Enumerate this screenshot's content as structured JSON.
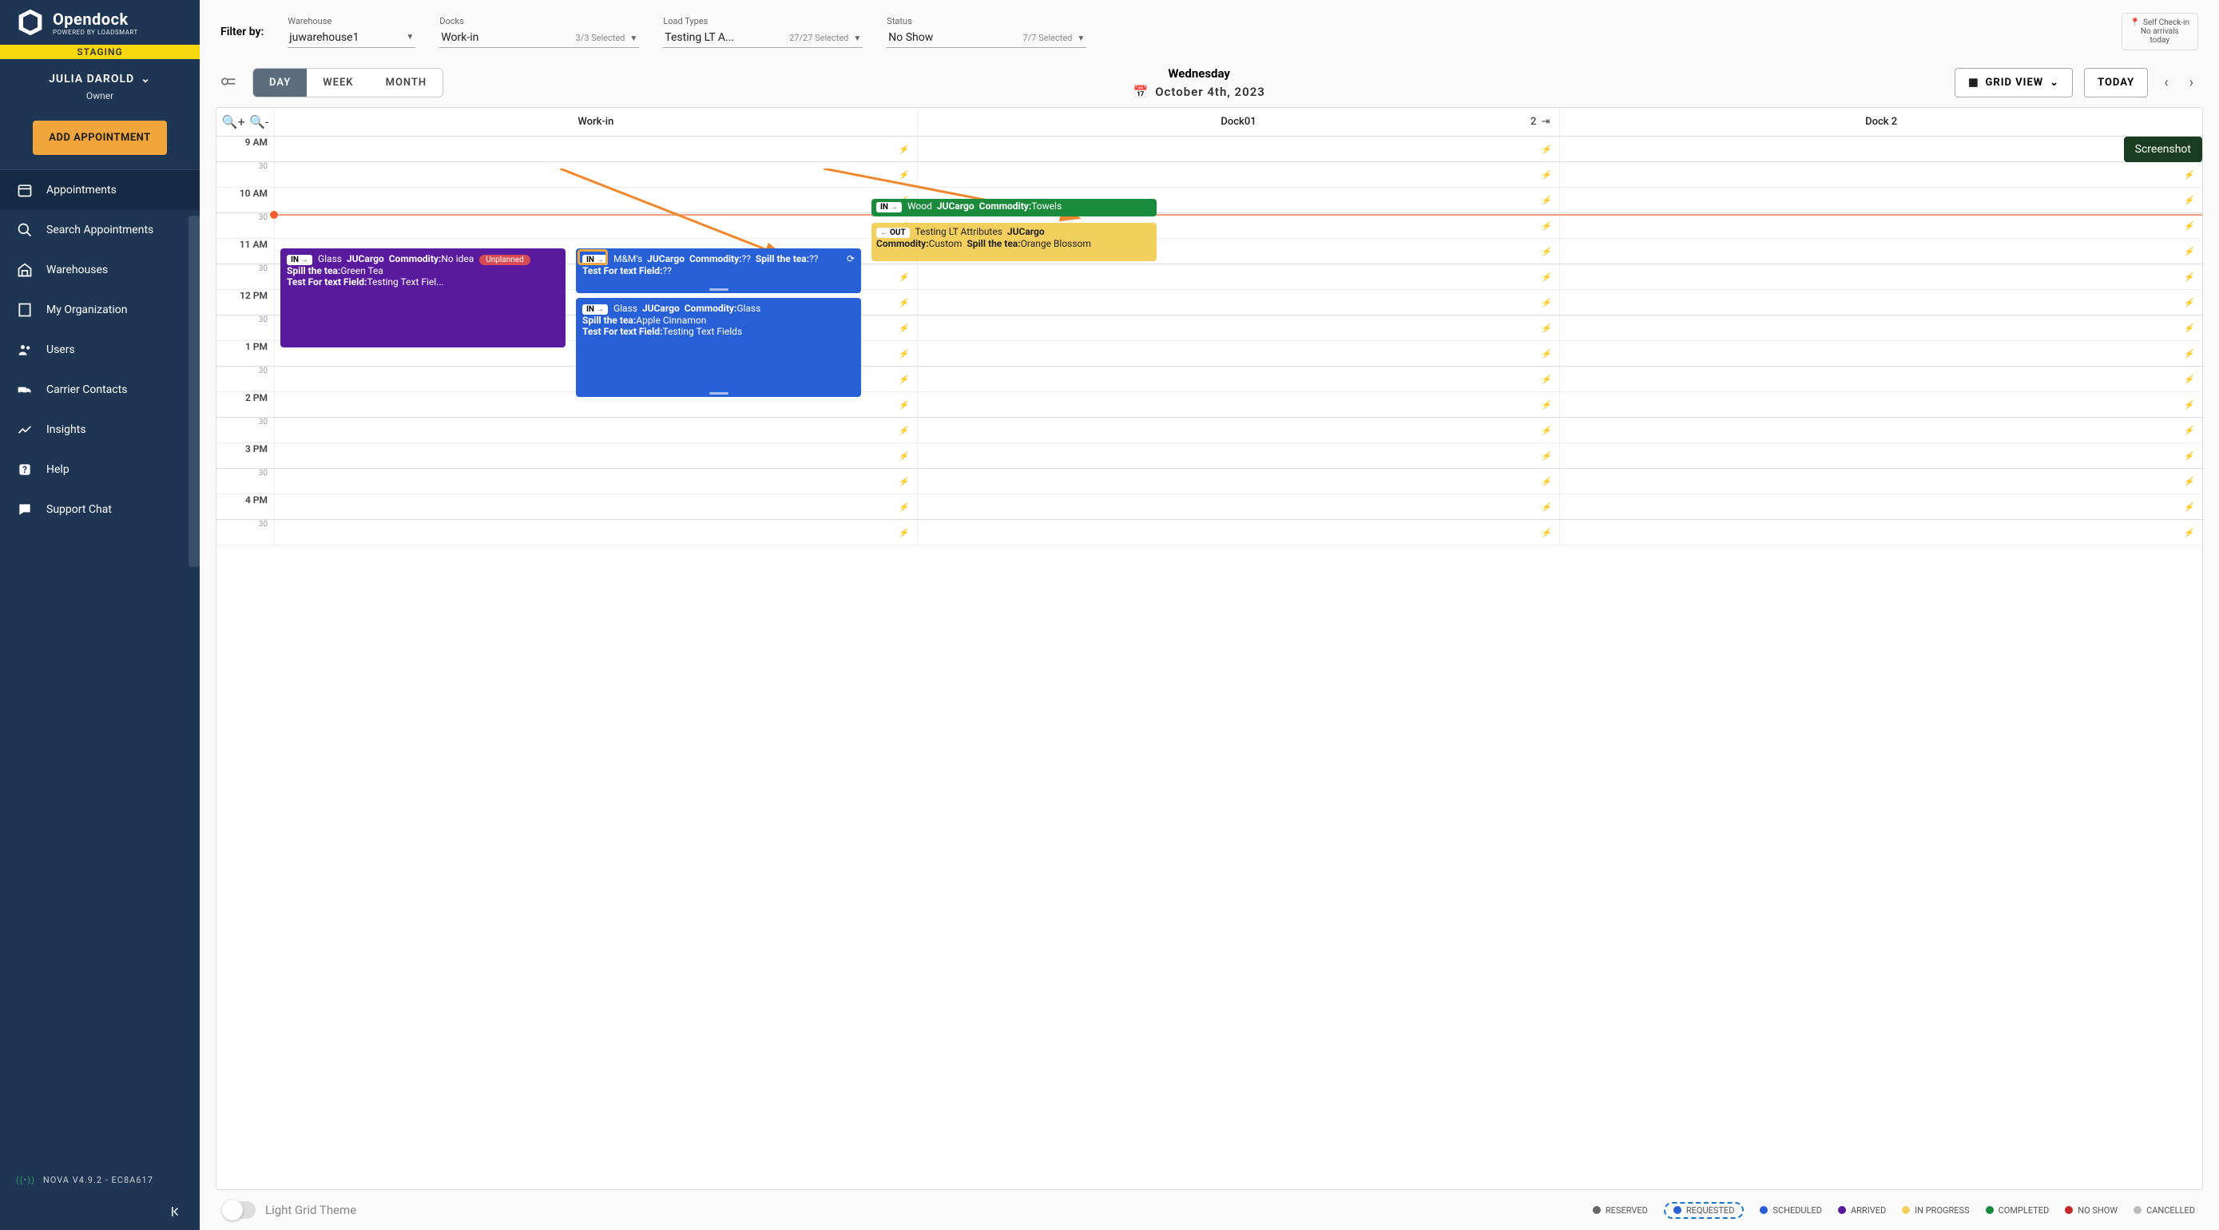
{
  "brand": {
    "name": "Opendock",
    "tagline": "POWERED BY LOADSMART",
    "env": "STAGING"
  },
  "user": {
    "name": "JULIA DAROLD",
    "role": "Owner"
  },
  "buttons": {
    "add_appointment": "ADD APPOINTMENT",
    "grid_view": "GRID VIEW",
    "today": "TODAY",
    "screenshot": "Screenshot"
  },
  "nav": {
    "items": [
      {
        "label": "Appointments",
        "icon": "calendar"
      },
      {
        "label": "Search Appointments",
        "icon": "search"
      },
      {
        "label": "Warehouses",
        "icon": "warehouse"
      },
      {
        "label": "My Organization",
        "icon": "org"
      },
      {
        "label": "Users",
        "icon": "users"
      },
      {
        "label": "Carrier Contacts",
        "icon": "truck"
      },
      {
        "label": "Insights",
        "icon": "chart"
      },
      {
        "label": "Help",
        "icon": "help"
      },
      {
        "label": "Support Chat",
        "icon": "chat"
      }
    ]
  },
  "version": "NOVA V4.9.2 - EC8A617",
  "filters": {
    "label": "Filter by:",
    "warehouse": {
      "label": "Warehouse",
      "value": "juwarehouse1"
    },
    "docks": {
      "label": "Docks",
      "value": "Work-in",
      "hint": "3/3 Selected"
    },
    "loadtypes": {
      "label": "Load Types",
      "value": "Testing LT A...",
      "hint": "27/27 Selected"
    },
    "status": {
      "label": "Status",
      "value": "No Show",
      "hint": "7/7 Selected"
    },
    "self_checkin": {
      "title": "Self Check-in",
      "line1": "No arrivals",
      "line2": "today"
    }
  },
  "toolbar": {
    "views": {
      "day": "DAY",
      "week": "WEEK",
      "month": "MONTH"
    },
    "day_name": "Wednesday",
    "date": "October 4th, 2023"
  },
  "grid": {
    "docks": [
      {
        "name": "Work-in"
      },
      {
        "name": "Dock01",
        "capacity": "2"
      },
      {
        "name": "Dock 2"
      }
    ],
    "hours": [
      "9 AM",
      "10 AM",
      "11 AM",
      "12 PM",
      "1 PM",
      "2 PM",
      "3 PM",
      "4 PM"
    ],
    "half": "30"
  },
  "appointments": {
    "a1": {
      "dir": "IN",
      "type": "Glass",
      "carrier": "JUCargo",
      "commodity_label": "Commodity:",
      "commodity": "No idea",
      "unplanned": "Unplanned",
      "spill_label": "Spill the tea:",
      "spill": "Green Tea",
      "test_label": "Test For text Field:",
      "test": "Testing Text Fiel..."
    },
    "a2": {
      "dir": "IN",
      "type": "M&M's",
      "carrier": "JUCargo",
      "commodity_label": "Commodity:",
      "commodity": "??",
      "spill_label": "Spill the tea:",
      "spill": "??",
      "test_label": "Test For text Field:",
      "test": "??"
    },
    "a3": {
      "dir": "IN",
      "type": "Glass",
      "carrier": "JUCargo",
      "commodity_label": "Commodity:",
      "commodity": "Glass",
      "spill_label": "Spill the tea:",
      "spill": "Apple Cinnamon",
      "test_label": "Test For text Field:",
      "test": "Testing Text Fields"
    },
    "a4": {
      "dir": "IN",
      "type": "Wood",
      "carrier": "JUCargo",
      "commodity_label": "Commodity:",
      "commodity": "Towels"
    },
    "a5": {
      "dir": "OUT",
      "type": "Testing LT Attributes",
      "carrier": "JUCargo",
      "commodity_label": "Commodity:",
      "commodity": "Custom",
      "spill_label": "Spill the tea:",
      "spill": "Orange Blossom"
    }
  },
  "theme_toggle": "Light Grid Theme",
  "legend": {
    "reserved": "RESERVED",
    "requested": "REQUESTED",
    "scheduled": "SCHEDULED",
    "arrived": "ARRIVED",
    "inprogress": "IN PROGRESS",
    "completed": "COMPLETED",
    "noshow": "NO SHOW",
    "cancelled": "CANCELLED"
  }
}
